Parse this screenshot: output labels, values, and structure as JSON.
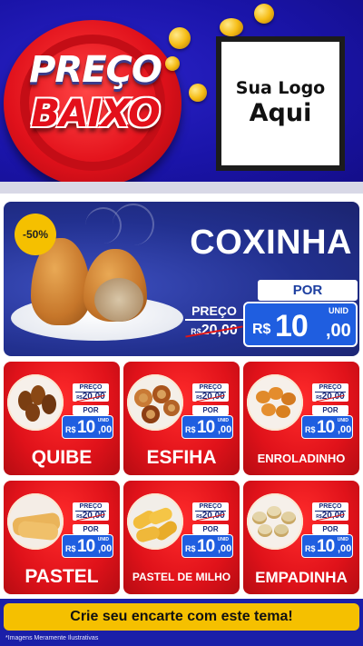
{
  "header": {
    "brand_top": "PREÇO",
    "brand_bottom": "BAIXO",
    "logo_line1": "Sua Logo",
    "logo_line2": "Aqui"
  },
  "hero": {
    "discount": "-50%",
    "title": "COXINHA",
    "old_label": "PREÇO",
    "old_currency": "R$",
    "old_price": "20,00",
    "por_label": "POR",
    "unit_label": "UNID",
    "currency": "R$",
    "price_int": "10",
    "price_cents": ",00"
  },
  "products": [
    {
      "name": "QUIBE",
      "old_label": "PREÇO",
      "old_currency": "R$",
      "old_price": "20,00",
      "por_label": "POR",
      "unit_label": "UNID",
      "currency": "R$",
      "price_int": "10",
      "price_cents": ",00"
    },
    {
      "name": "ESFIHA",
      "old_label": "PREÇO",
      "old_currency": "R$",
      "old_price": "20,00",
      "por_label": "POR",
      "unit_label": "UNID",
      "currency": "R$",
      "price_int": "10",
      "price_cents": ",00"
    },
    {
      "name": "ENROLADINHO",
      "old_label": "PREÇO",
      "old_currency": "R$",
      "old_price": "20,00",
      "por_label": "POR",
      "unit_label": "UNID",
      "currency": "R$",
      "price_int": "10",
      "price_cents": ",00"
    },
    {
      "name": "PASTEL",
      "old_label": "PREÇO",
      "old_currency": "R$",
      "old_price": "20,00",
      "por_label": "POR",
      "unit_label": "UNID",
      "currency": "R$",
      "price_int": "10",
      "price_cents": ",00"
    },
    {
      "name": "PASTEL DE MILHO",
      "old_label": "PREÇO",
      "old_currency": "R$",
      "old_price": "20,00",
      "por_label": "POR",
      "unit_label": "UNID",
      "currency": "R$",
      "price_int": "10",
      "price_cents": ",00"
    },
    {
      "name": "EMPADINHA",
      "old_label": "PREÇO",
      "old_currency": "R$",
      "old_price": "20,00",
      "por_label": "POR",
      "unit_label": "UNID",
      "currency": "R$",
      "price_int": "10",
      "price_cents": ",00"
    }
  ],
  "footer": {
    "cta": "Crie seu encarte com este tema!",
    "disclaimer": "*Imagens Meramente Ilustrativas"
  },
  "colors": {
    "header_blue": "#1a14a8",
    "brand_red": "#e0111b",
    "card_red": "#e0121a",
    "price_blue": "#1f5ee0",
    "accent_yellow": "#f5c000",
    "hero_blue": "#22308f"
  }
}
